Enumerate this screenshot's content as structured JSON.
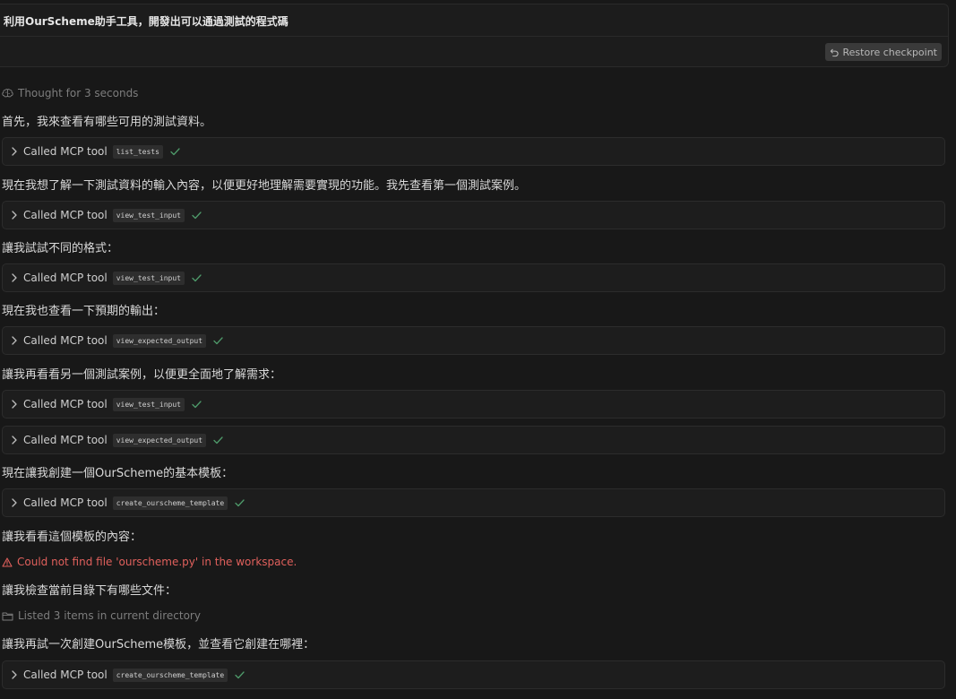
{
  "prompt": {
    "text": "利用OurScheme助手工具，開發出可以通過測試的程式碼",
    "restore_label": "Restore checkpoint"
  },
  "thought": {
    "label": "Thought for 3 seconds"
  },
  "messages": [
    "首先，我來查看有哪些可用的測試資料。",
    "現在我想了解一下測試資料的輸入內容，以便更好地理解需要實現的功能。我先查看第一個測試案例。",
    "讓我試試不同的格式：",
    "現在我也查看一下預期的輸出：",
    "讓我再看看另一個測試案例，以便更全面地了解需求：",
    "現在讓我創建一個OurScheme的基本模板：",
    "讓我看看這個模板的內容：",
    "讓我檢查當前目錄下有哪些文件：",
    "讓我再試一次創建OurScheme模板，並查看它創建在哪裡："
  ],
  "tool_label": "Called MCP tool",
  "tools": [
    "list_tests",
    "view_test_input",
    "view_test_input",
    "view_expected_output",
    "view_test_input",
    "view_expected_output",
    "create_ourscheme_template",
    "create_ourscheme_template"
  ],
  "error": {
    "text": "Could not find file 'ourscheme.py' in the workspace."
  },
  "listed": {
    "text": "Listed 3 items in current directory"
  },
  "colors": {
    "background": "#181818",
    "check_green": "#4e9a6a",
    "error_red": "#e0605c",
    "muted_text": "#7d7d7d"
  },
  "icons": {
    "restore": "undo-arrow-icon",
    "thought": "brain-icon",
    "tool_expand": "chevron-right-icon",
    "tool_status": "check-icon",
    "error": "warning-triangle-icon",
    "listed": "folder-icon"
  }
}
